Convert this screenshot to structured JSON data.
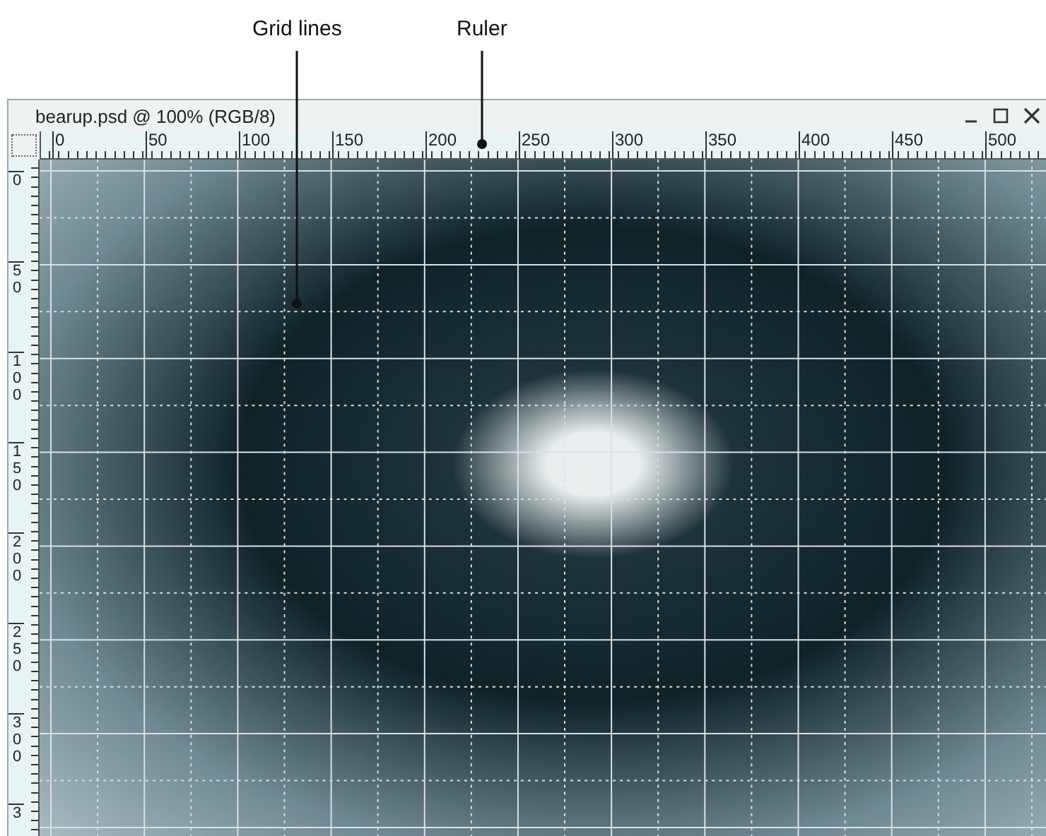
{
  "callouts": [
    {
      "label": "Grid lines"
    },
    {
      "label": "Ruler"
    }
  ],
  "window": {
    "title": "bearup.psd @ 100% (RGB/8)"
  },
  "rulers": {
    "horizontal": [
      "0",
      "50",
      "100",
      "150",
      "200",
      "250",
      "300",
      "350",
      "400",
      "450",
      "500"
    ],
    "vertical": [
      "0",
      "50",
      "100",
      "150",
      "200",
      "250",
      "300",
      "3"
    ]
  }
}
